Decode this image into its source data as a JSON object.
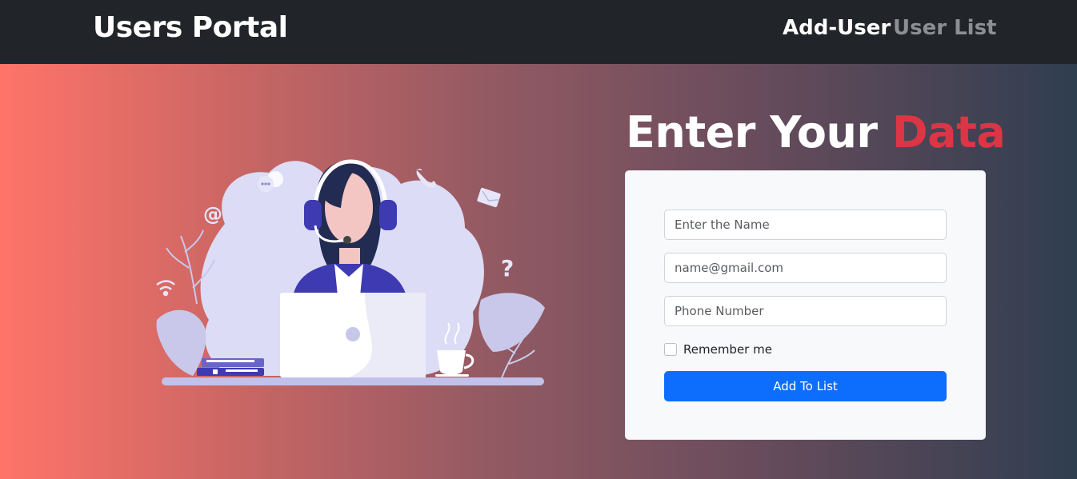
{
  "navbar": {
    "brand": "Users Portal",
    "links": [
      {
        "label": "Add-User",
        "active": true
      },
      {
        "label": "User List",
        "active": false
      }
    ]
  },
  "hero": {
    "heading_main": "Enter Your",
    "heading_accent": "Data",
    "accent_color": "#dc3545",
    "illustration": "customer-support-agent-illustration"
  },
  "form": {
    "name_placeholder": "Enter the Name",
    "email_placeholder": "name@gmail.com",
    "phone_placeholder": "Phone Number",
    "remember_label": "Remember me",
    "remember_checked": false,
    "submit_label": "Add To List",
    "submit_color": "#0d6efd"
  }
}
